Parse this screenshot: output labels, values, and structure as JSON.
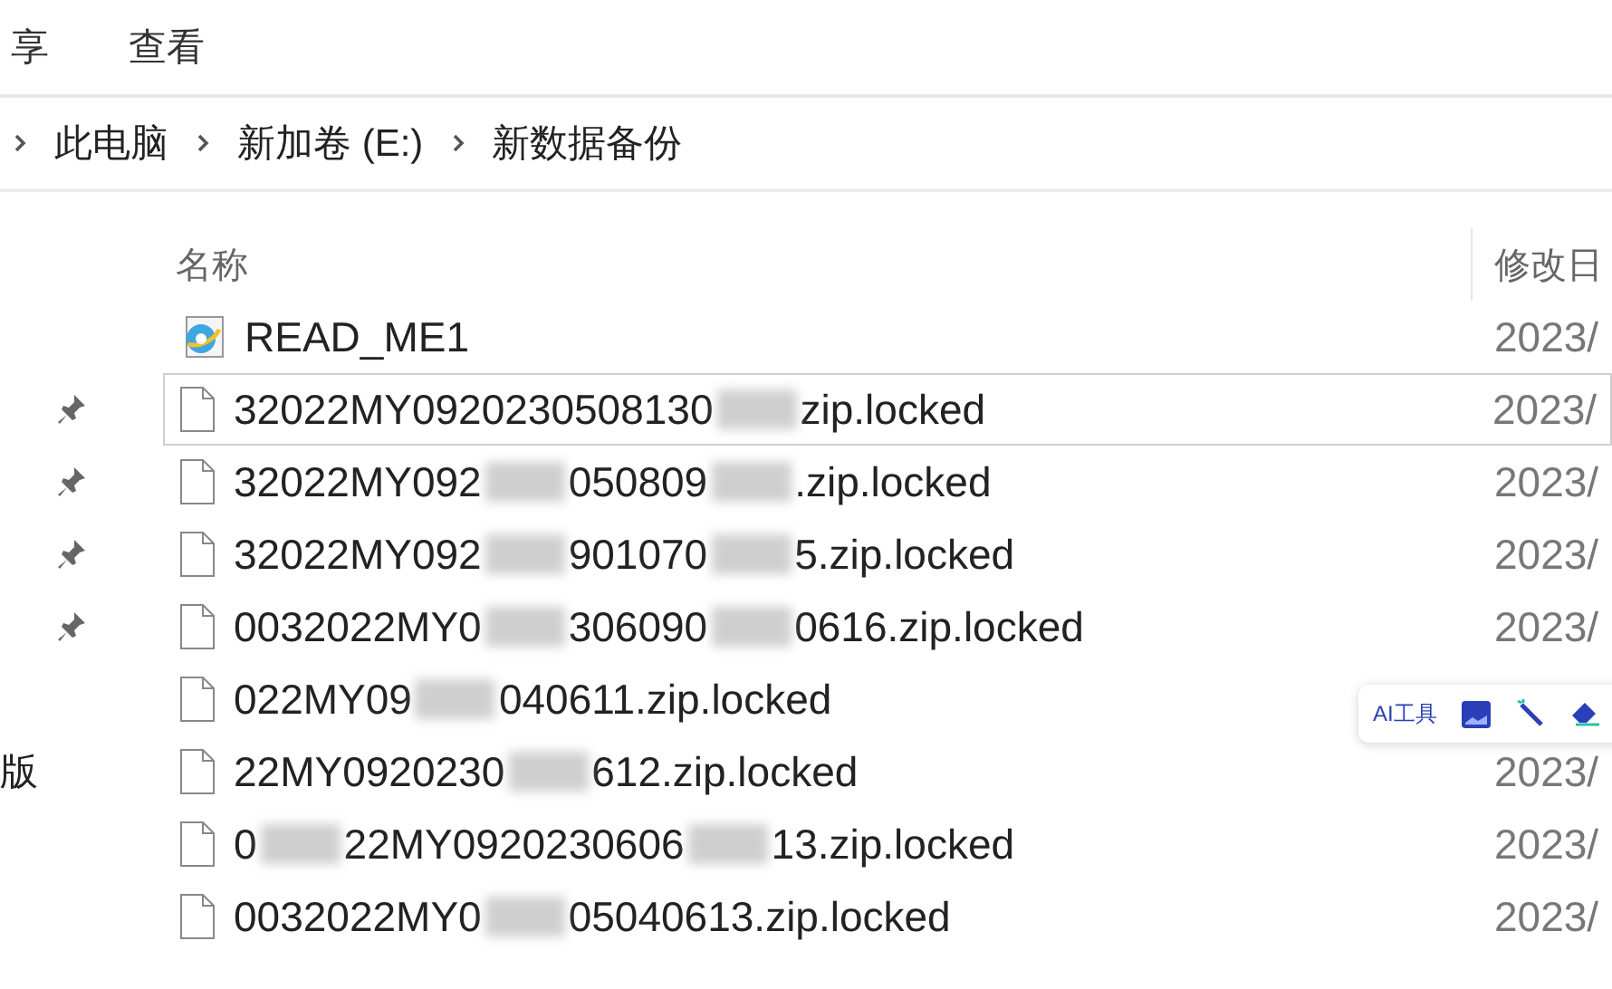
{
  "ribbon": {
    "tabs": [
      {
        "label": "享"
      },
      {
        "label": "查看"
      }
    ]
  },
  "address_bar": {
    "crumbs": [
      "此电脑",
      "新加卷 (E:)",
      "新数据备份"
    ]
  },
  "nav_pane": {
    "items": [
      {
        "pinned": false
      },
      {
        "pinned": true
      },
      {
        "pinned": true
      },
      {
        "pinned": true
      },
      {
        "pinned": true
      },
      {
        "pinned": false
      },
      {
        "pinned": false,
        "label": "版"
      },
      {
        "pinned": false
      },
      {
        "pinned": false
      }
    ]
  },
  "file_list": {
    "columns": [
      "名称",
      "修改日"
    ],
    "rows": [
      {
        "kind": "html",
        "segments": [
          "READ_ME1"
        ],
        "modified": "2023/",
        "selected": false
      },
      {
        "kind": "file",
        "segments": [
          "32022MY0920230508130",
          "zip.locked"
        ],
        "modified": "2023/",
        "selected": true
      },
      {
        "kind": "file",
        "segments": [
          "32022MY092",
          "050809",
          ".zip.locked"
        ],
        "modified": "2023/",
        "selected": false
      },
      {
        "kind": "file",
        "segments": [
          "32022MY092",
          "901070",
          "5.zip.locked"
        ],
        "modified": "2023/",
        "selected": false
      },
      {
        "kind": "file",
        "segments": [
          "0032022MY0",
          "306090",
          "0616.zip.locked"
        ],
        "modified": "2023/",
        "selected": false
      },
      {
        "kind": "file",
        "segments": [
          "022MY09",
          "040611.zip.locked"
        ],
        "selected": false
      },
      {
        "kind": "file",
        "segments": [
          "22MY0920230",
          "612.zip.locked"
        ],
        "modified": "2023/",
        "selected": false
      },
      {
        "kind": "file",
        "segments": [
          "0",
          "22MY0920230606",
          "13.zip.locked"
        ],
        "modified": "2023/",
        "selected": false
      },
      {
        "kind": "file",
        "segments": [
          "0032022MY0",
          "05040613.zip.locked"
        ],
        "modified": "2023/",
        "selected": false
      }
    ]
  },
  "floating_toolbar": {
    "label": "AI工具"
  }
}
